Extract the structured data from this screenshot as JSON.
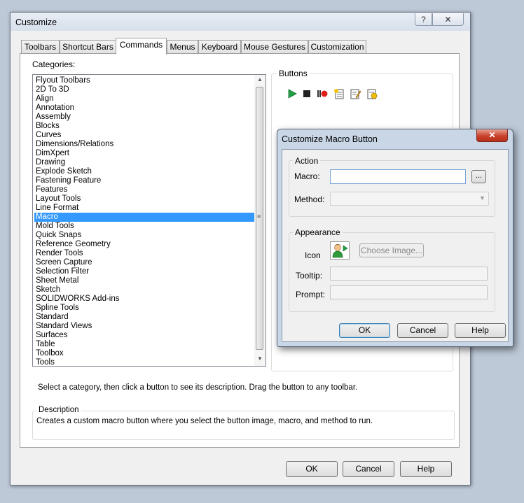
{
  "window": {
    "title": "Customize",
    "help_glyph": "?",
    "close_glyph": "✕"
  },
  "tabs": [
    {
      "label": "Toolbars"
    },
    {
      "label": "Shortcut Bars"
    },
    {
      "label": "Commands"
    },
    {
      "label": "Menus"
    },
    {
      "label": "Keyboard"
    },
    {
      "label": "Mouse Gestures"
    },
    {
      "label": "Customization"
    }
  ],
  "active_tab": "Commands",
  "categories": {
    "label": "Categories:",
    "selected": "Macro",
    "items": [
      "Flyout Toolbars",
      "2D To 3D",
      "Align",
      "Annotation",
      "Assembly",
      "Blocks",
      "Curves",
      "Dimensions/Relations",
      "DimXpert",
      "Drawing",
      "Explode Sketch",
      "Fastening Feature",
      "Features",
      "Layout Tools",
      "Line Format",
      "Macro",
      "Mold Tools",
      "Quick Snaps",
      "Reference Geometry",
      "Render Tools",
      "Screen Capture",
      "Selection Filter",
      "Sheet Metal",
      "Sketch",
      "SOLIDWORKS Add-ins",
      "Spline Tools",
      "Standard",
      "Standard Views",
      "Surfaces",
      "Table",
      "Toolbox",
      "Tools"
    ]
  },
  "buttons_group": {
    "label": "Buttons",
    "icons": [
      "run-macro-icon",
      "stop-macro-icon",
      "record-macro-icon",
      "new-macro-icon",
      "edit-macro-icon",
      "customize-macro-icon"
    ]
  },
  "hint": "Select a category, then click a button to see its description. Drag the button to any toolbar.",
  "description": {
    "label": "Description",
    "text": "Creates a custom macro button where you select the button image, macro, and method to run."
  },
  "footer": {
    "ok": "OK",
    "cancel": "Cancel",
    "help": "Help"
  },
  "macro_dialog": {
    "title": "Customize Macro Button",
    "close_glyph": "✕",
    "action": {
      "label": "Action",
      "macro_label": "Macro:",
      "macro_value": "",
      "browse_label": "...",
      "method_label": "Method:",
      "method_value": ""
    },
    "appearance": {
      "label": "Appearance",
      "icon_label": "Icon",
      "icon_name": "macro-user-icon",
      "choose_image_label": "Choose Image...",
      "tooltip_label": "Tooltip:",
      "tooltip_value": "",
      "prompt_label": "Prompt:",
      "prompt_value": ""
    },
    "ok": "OK",
    "cancel": "Cancel",
    "help": "Help"
  }
}
